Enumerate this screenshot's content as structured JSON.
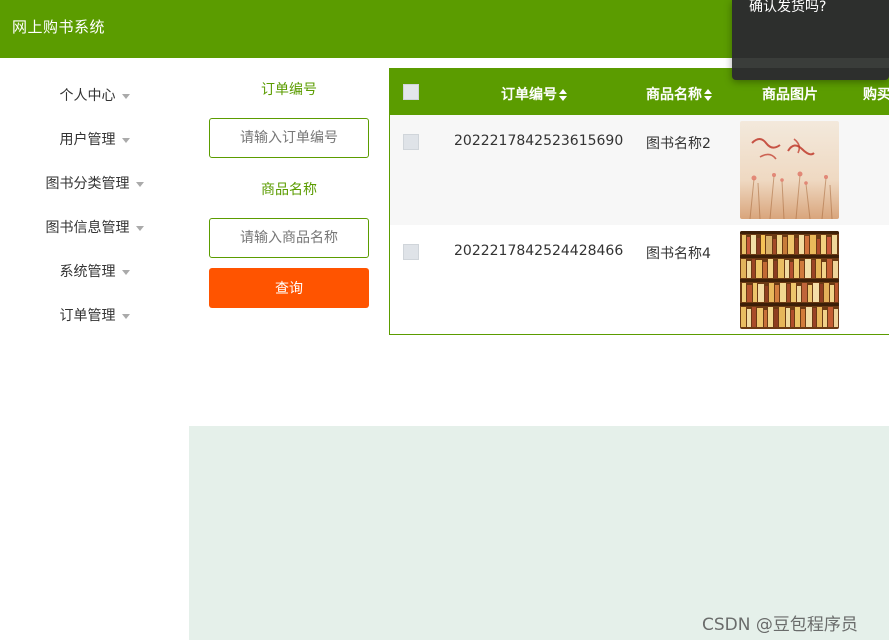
{
  "app": {
    "title": "网上购书系统"
  },
  "sidebar": {
    "items": [
      {
        "label": "个人中心"
      },
      {
        "label": "用户管理"
      },
      {
        "label": "图书分类管理"
      },
      {
        "label": "图书信息管理"
      },
      {
        "label": "系统管理"
      },
      {
        "label": "订单管理"
      }
    ]
  },
  "filters": {
    "order_no_label": "订单编号",
    "order_no_placeholder": "请输入订单编号",
    "product_label": "商品名称",
    "product_placeholder": "请输入商品名称",
    "query_button": "查询"
  },
  "table": {
    "headers": {
      "order_no": "订单编号",
      "product_name": "商品名称",
      "image": "商品图片",
      "buy": "购买"
    },
    "rows": [
      {
        "order_no": "2022217842523615690",
        "product_name": "图书名称2",
        "image_desc": "book-cover-flowers"
      },
      {
        "order_no": "2022217842524428466",
        "product_name": "图书名称4",
        "image_desc": "bookshelf-photo"
      }
    ]
  },
  "popover": {
    "text": "确认发货吗?"
  },
  "watermark": "CSDN @豆包程序员",
  "colors": {
    "brand_green": "#5b9c00",
    "query_orange": "#ff5400",
    "content_bg": "#e5f0ea",
    "popover_bg": "#2d2f2d"
  }
}
